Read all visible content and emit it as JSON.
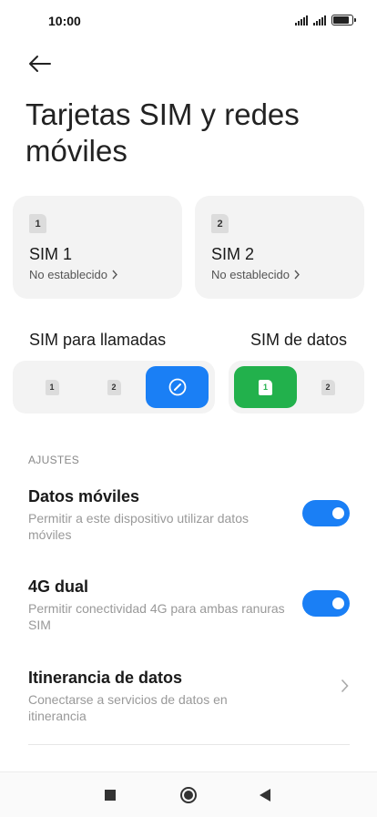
{
  "status_bar": {
    "time": "10:00",
    "icons": [
      "signal-icon",
      "signal-icon",
      "battery-icon"
    ]
  },
  "header": {
    "back_icon": "arrow-left-icon",
    "title": "Tarjetas SIM y redes móviles"
  },
  "sim_cards": [
    {
      "badge": "1",
      "name": "SIM 1",
      "status": "No establecido"
    },
    {
      "badge": "2",
      "name": "SIM 2",
      "status": "No establecido"
    }
  ],
  "calls_sim": {
    "label": "SIM para llamadas",
    "options": [
      "1",
      "2"
    ],
    "selected": "always-ask-icon",
    "accent": "#1a7ff5"
  },
  "data_sim": {
    "label": "SIM de datos",
    "options": [
      "1",
      "2"
    ],
    "selected": "1",
    "accent": "#22b14c"
  },
  "settings": {
    "header": "AJUSTES",
    "items": [
      {
        "title": "Datos móviles",
        "desc": "Permitir a este dispositivo utilizar datos móviles",
        "control": "toggle",
        "on": true
      },
      {
        "title": "4G dual",
        "desc": "Permitir conectividad 4G para ambas ranuras SIM",
        "control": "toggle",
        "on": true
      },
      {
        "title": "Itinerancia de datos",
        "desc": "Conectarse a servicios de datos en itinerancia",
        "control": "chevron"
      }
    ]
  },
  "nav_bar": {
    "buttons": [
      "recents-square-icon",
      "home-circle-icon",
      "back-triangle-icon"
    ]
  }
}
